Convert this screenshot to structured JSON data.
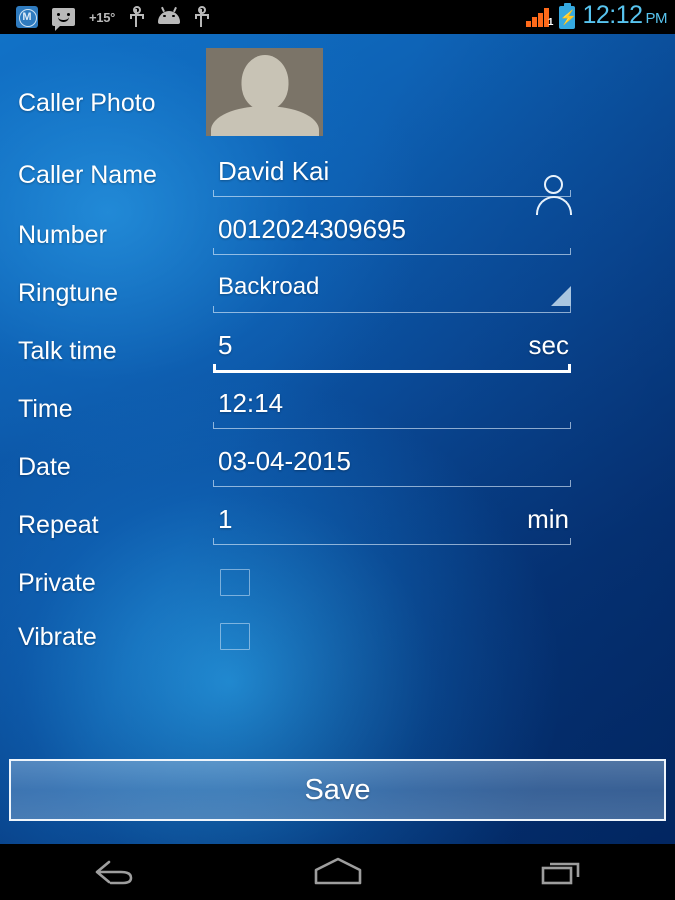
{
  "status_bar": {
    "left_icons": [
      {
        "name": "muzei-icon",
        "glyph": "M"
      },
      {
        "name": "sms-smiley-icon",
        "glyph": ""
      },
      {
        "name": "temperature-indicator",
        "glyph": "+15°"
      },
      {
        "name": "usb-icon",
        "glyph": ""
      },
      {
        "name": "android-head-icon",
        "glyph": ""
      },
      {
        "name": "usb-debug-icon",
        "glyph": ""
      }
    ],
    "temperature": "+15°",
    "signal_sim_badge": "1",
    "battery_charging_glyph": "⚡",
    "clock_time": "12:12",
    "clock_ampm": "PM",
    "clock_color": "#58c4ef",
    "signal_color": "#ff6a1a",
    "battery_color": "#35a9e0"
  },
  "form": {
    "photo_row": {
      "label": "Caller Photo"
    },
    "fields": [
      {
        "label": "Caller Name",
        "value": "David Kai",
        "unit": "",
        "focused": false,
        "type": "text"
      },
      {
        "label": "Number",
        "value": "0012024309695",
        "unit": "",
        "focused": false,
        "type": "text"
      },
      {
        "label": "Ringtune",
        "value": "Backroad",
        "unit": "",
        "focused": false,
        "type": "spinner"
      },
      {
        "label": "Talk time",
        "value": "5",
        "unit": "sec",
        "focused": true,
        "type": "number"
      },
      {
        "label": "Time",
        "value": "12:14",
        "unit": "",
        "focused": false,
        "type": "time"
      },
      {
        "label": "Date",
        "value": "03-04-2015",
        "unit": "",
        "focused": false,
        "type": "date"
      },
      {
        "label": "Repeat",
        "value": "1",
        "unit": "min",
        "focused": false,
        "type": "number"
      }
    ],
    "checkboxes": [
      {
        "label": "Private",
        "checked": false
      },
      {
        "label": "Vibrate",
        "checked": false
      }
    ],
    "save_label": "Save"
  },
  "nav_bar": {
    "buttons": [
      {
        "name": "back-button"
      },
      {
        "name": "home-button"
      },
      {
        "name": "recents-button"
      }
    ]
  },
  "colors": {
    "background_blue_light": "#1584d4",
    "background_blue_dark": "#04306d",
    "text_white": "#ffffff",
    "photo_bg": "#7b7468",
    "photo_silhouette": "#c8c3b5"
  }
}
